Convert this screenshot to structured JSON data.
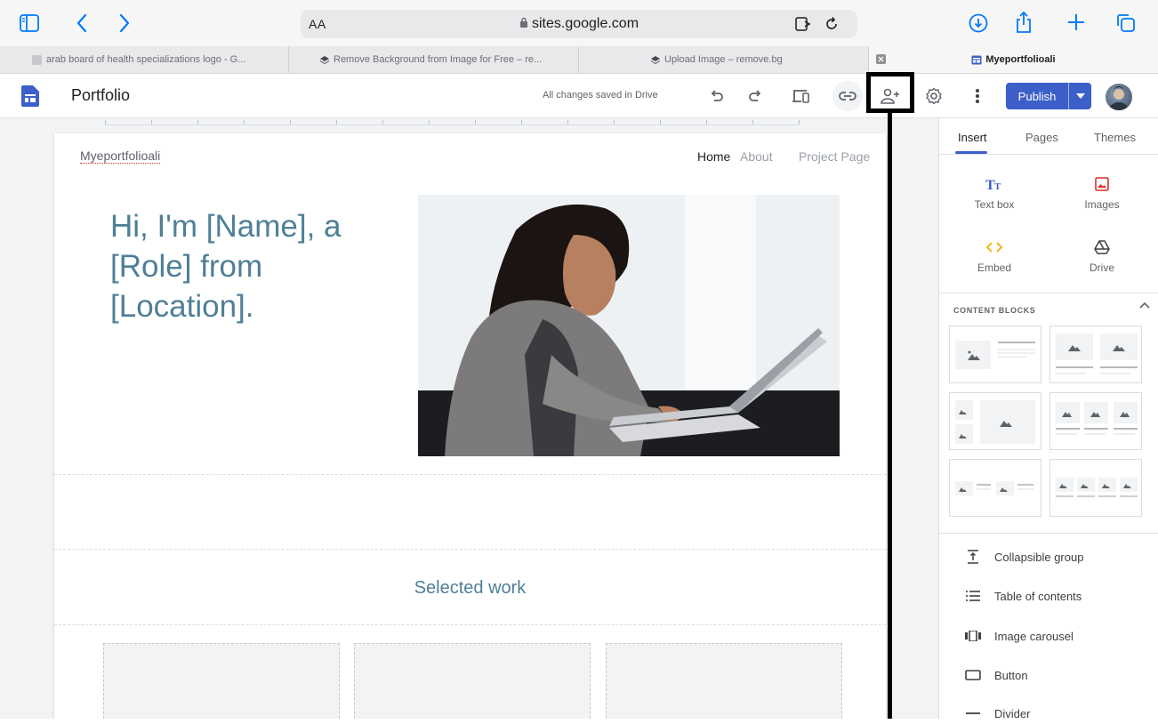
{
  "browser": {
    "url": "sites.google.com",
    "reader_label": "AA",
    "tabs": [
      {
        "label": "arab board of health specializations logo - G..."
      },
      {
        "label": "Remove Background from Image for Free – re..."
      },
      {
        "label": "Upload Image – remove.bg"
      },
      {
        "label": "Myeportfolioali"
      }
    ]
  },
  "header": {
    "title": "Portfolio",
    "save_status": "All changes saved in Drive",
    "publish_label": "Publish"
  },
  "site": {
    "name": "Myeportfolioali",
    "nav": [
      "Home",
      "About",
      "Project Page"
    ],
    "hero_text": "Hi, I'm [Name], a [Role] from [Location].",
    "section_title": "Selected work"
  },
  "panel": {
    "tabs": [
      "Insert",
      "Pages",
      "Themes"
    ],
    "insert_items": [
      {
        "label": "Text box",
        "icon": "text-box-icon"
      },
      {
        "label": "Images",
        "icon": "image-icon"
      },
      {
        "label": "Embed",
        "icon": "embed-icon"
      },
      {
        "label": "Drive",
        "icon": "drive-icon"
      }
    ],
    "content_blocks_title": "CONTENT BLOCKS",
    "list_items": [
      {
        "label": "Collapsible group",
        "icon": "collapsible-icon"
      },
      {
        "label": "Table of contents",
        "icon": "toc-icon"
      },
      {
        "label": "Image carousel",
        "icon": "carousel-icon"
      },
      {
        "label": "Button",
        "icon": "button-icon"
      },
      {
        "label": "Divider",
        "icon": "divider-icon"
      }
    ]
  },
  "colors": {
    "accent": "#3c5fc9",
    "hero_text": "#4f7f97",
    "image_icon": "#d93025",
    "embed_icon": "#f9ab00"
  }
}
